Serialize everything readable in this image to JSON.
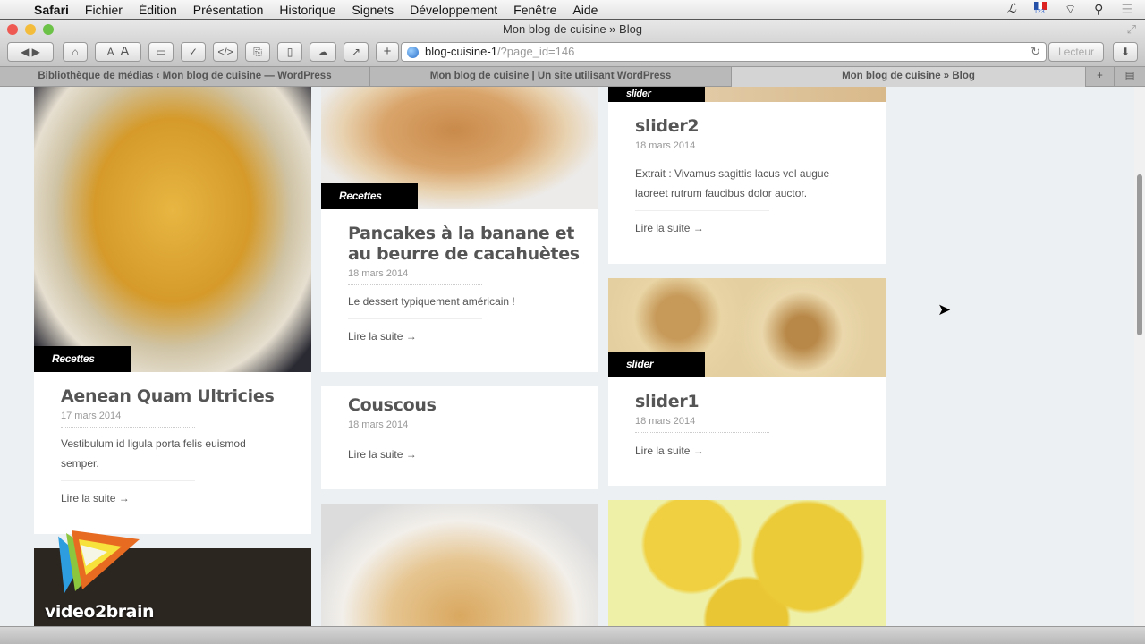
{
  "menubar": {
    "app": "Safari",
    "items": [
      "Fichier",
      "Édition",
      "Présentation",
      "Historique",
      "Signets",
      "Développement",
      "Fenêtre",
      "Aide"
    ],
    "keyboard_label": "123"
  },
  "window": {
    "title": "Mon blog de cuisine » Blog"
  },
  "toolbar": {
    "url_host": "blog-cuisine-1",
    "url_path": "/?page_id=146",
    "reader_label": "Lecteur",
    "font_small": "A",
    "font_large": "A",
    "code": "</>",
    "add": "+"
  },
  "tabs": [
    {
      "label": "Bibliothèque de médias ‹ Mon blog de cuisine — WordPress"
    },
    {
      "label": "Mon blog de cuisine | Un site utilisant WordPress"
    },
    {
      "label": "Mon blog de cuisine » Blog",
      "active": true
    }
  ],
  "posts": [
    {
      "category": "Recettes",
      "title": "Aenean Quam Ultricies",
      "date": "17 mars 2014",
      "excerpt": "Vestibulum id ligula porta felis euismod semper.",
      "more": "Lire la suite →"
    },
    {
      "category": "Recettes",
      "title": "Pancakes à la banane et au beurre de cacahuètes",
      "date": "18 mars 2014",
      "excerpt": "Le dessert typiquement américain !",
      "more": "Lire la suite →"
    },
    {
      "title": "Couscous",
      "date": "18 mars 2014",
      "more": "Lire la suite →"
    },
    {
      "category": "slider",
      "title": "slider2",
      "date": "18 mars 2014",
      "excerpt": "Extrait : Vivamus sagittis lacus vel augue laoreet rutrum faucibus dolor auctor.",
      "more": "Lire la suite →"
    },
    {
      "category": "slider",
      "title": "slider1",
      "date": "18 mars 2014",
      "more": "Lire la suite →"
    }
  ],
  "watermark": "video2brain"
}
